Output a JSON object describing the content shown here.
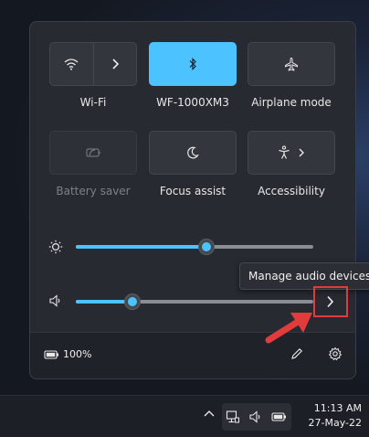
{
  "quick_settings": {
    "tiles": [
      {
        "label": "Wi-Fi",
        "state": "off",
        "icon": "wifi-icon",
        "has_chevron": true
      },
      {
        "label": "WF-1000XM3",
        "state": "active",
        "icon": "bluetooth-icon"
      },
      {
        "label": "Airplane mode",
        "state": "off",
        "icon": "airplane-icon"
      },
      {
        "label": "Battery saver",
        "state": "disabled",
        "icon": "battery-saver-icon"
      },
      {
        "label": "Focus assist",
        "state": "off",
        "icon": "moon-icon"
      },
      {
        "label": "Accessibility",
        "state": "off",
        "icon": "accessibility-icon",
        "has_chevron": true
      }
    ],
    "brightness": {
      "icon": "brightness-icon",
      "value": 0.55
    },
    "volume": {
      "icon": "speaker-icon",
      "value": 0.24
    },
    "tooltip": "Manage audio devices",
    "footer": {
      "battery_percent": "100%"
    }
  },
  "taskbar": {
    "time": "11:13 AM",
    "date": "27-May-22"
  },
  "colors": {
    "accent": "#4cc2ff",
    "annotation": "#e23b3b",
    "panel": "#272a31"
  }
}
